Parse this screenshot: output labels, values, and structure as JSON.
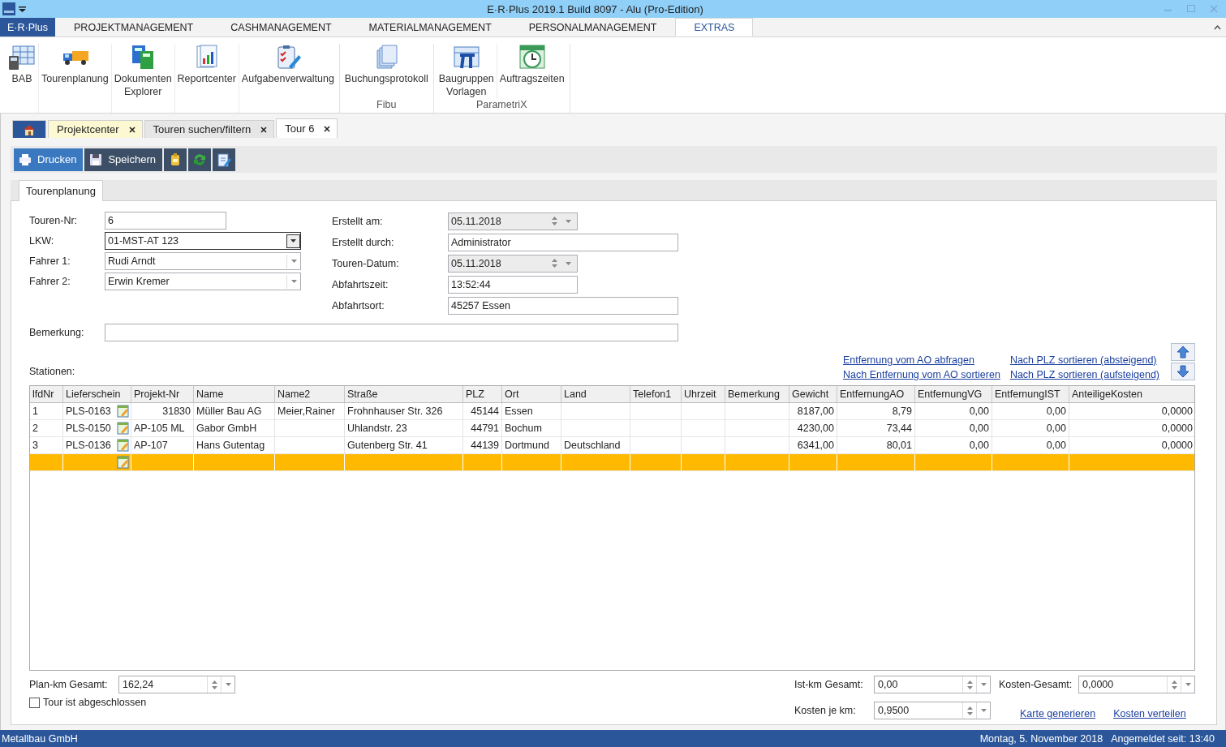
{
  "window": {
    "title": "E·R·Plus 2019.1 Build 8097 -  Alu (Pro-Edition)"
  },
  "menu": {
    "tabs": [
      {
        "label": "E·R·Plus",
        "kind": "app",
        "selected": false
      },
      {
        "label": "PROJEKTMANAGEMENT",
        "kind": "tab",
        "selected": false
      },
      {
        "label": "CASHMANAGEMENT",
        "kind": "tab",
        "selected": false
      },
      {
        "label": "MATERIALMANAGEMENT",
        "kind": "tab",
        "selected": false
      },
      {
        "label": "PERSONALMANAGEMENT",
        "kind": "tab",
        "selected": false
      },
      {
        "label": "EXTRAS",
        "kind": "tab",
        "selected": true
      }
    ]
  },
  "ribbon": {
    "groups": [
      {
        "items": [
          {
            "label": "BAB"
          },
          {
            "label": "Tourenplanung"
          },
          {
            "label": "Dokumenten\nExplorer"
          },
          {
            "label": "Reportcenter"
          },
          {
            "label": "Aufgabenverwaltung"
          }
        ]
      },
      {
        "label": "Fibu",
        "items": [
          {
            "label": "Buchungsprotokoll"
          }
        ]
      },
      {
        "label": "ParametriX",
        "items": [
          {
            "label": "Baugruppen\nVorlagen"
          },
          {
            "label": "Auftragszeiten"
          }
        ]
      }
    ]
  },
  "document_tabs": [
    {
      "kind": "home",
      "selected": false
    },
    {
      "kind": "tab",
      "label": "Projektcenter",
      "selected": false,
      "color": "#fbf8d2"
    },
    {
      "kind": "tab",
      "label": "Touren suchen/filtern",
      "selected": false,
      "color": "#e6e6e6"
    },
    {
      "kind": "tab",
      "label": "Tour 6",
      "selected": true
    }
  ],
  "toolbar": [
    {
      "kind": "primary",
      "label": "Drucken"
    },
    {
      "kind": "dark",
      "label": "Speichern"
    },
    {
      "kind": "icon"
    },
    {
      "kind": "icon"
    },
    {
      "kind": "icon"
    }
  ],
  "page_tabs": [
    {
      "label": "Tourenplanung",
      "selected": true
    }
  ],
  "form": {
    "left": [
      {
        "label": "Touren-Nr:",
        "value": "6",
        "kind": "text",
        "focused": false
      },
      {
        "label": "LKW:",
        "value": "01-MST-AT 123",
        "kind": "combo",
        "focused": true
      },
      {
        "label": "Fahrer 1:",
        "value": "Rudi Arndt",
        "kind": "combo",
        "focused": false
      },
      {
        "label": "Fahrer 2:",
        "value": "Erwin Kremer",
        "kind": "combo",
        "focused": false
      }
    ],
    "right": [
      {
        "label": "Erstellt am:",
        "value": "05.11.2018",
        "kind": "date",
        "disabled": true
      },
      {
        "label": "Erstellt durch:",
        "value": "Administrator",
        "kind": "wide",
        "disabled": false
      },
      {
        "label": "Touren-Datum:",
        "value": "05.11.2018",
        "kind": "date",
        "disabled": true
      },
      {
        "label": "Abfahrtszeit:",
        "value": "13:52:44",
        "kind": "text",
        "disabled": false
      },
      {
        "label": "Abfahrtsort:",
        "value": "45257 Essen",
        "kind": "wide",
        "disabled": false
      }
    ],
    "remark": {
      "label": "Bemerkung:"
    }
  },
  "stations": {
    "label": "Stationen:",
    "links": [
      "Entfernung vom AO abfragen",
      "Nach PLZ sortieren (absteigend)",
      "Nach Entfernung vom AO sortieren",
      "Nach PLZ sortieren (aufsteigend)"
    ],
    "columns": [
      "lfdNr",
      "Lieferschein",
      "Projekt-Nr",
      "Name",
      "Name2",
      "Straße",
      "PLZ",
      "Ort",
      "Land",
      "Telefon1",
      "Uhrzeit",
      "Bemerkung",
      "Gewicht",
      "EntfernungAO",
      "EntfernungVG",
      "EntfernungIST",
      "AnteiligeKosten"
    ],
    "rows": [
      {
        "selected": false,
        "cells": [
          "1",
          "PLS-0163",
          "31830",
          "Müller Bau AG",
          "Meier,Rainer",
          "Frohnhauser Str. 326",
          "45144",
          "Essen",
          null,
          null,
          null,
          null,
          "8187,00",
          "8,79",
          "0,00",
          "0,00",
          "0,0000"
        ]
      },
      {
        "selected": false,
        "cells": [
          "2",
          "PLS-0150",
          "AP-105 ML",
          "Gabor GmbH",
          null,
          "Uhlandstr. 23",
          "44791",
          "Bochum",
          null,
          null,
          null,
          null,
          "4230,00",
          "73,44",
          "0,00",
          "0,00",
          "0,0000"
        ]
      },
      {
        "selected": false,
        "cells": [
          "3",
          "PLS-0136",
          "AP-107",
          "Hans Gutentag",
          null,
          "Gutenberg Str. 41",
          "44139",
          "Dortmund",
          "Deutschland",
          null,
          null,
          null,
          "6341,00",
          "80,01",
          "0,00",
          "0,00",
          "0,0000"
        ]
      },
      {
        "selected": true,
        "cells": [
          null,
          null,
          null,
          null,
          null,
          null,
          null,
          null,
          null,
          null,
          null,
          null,
          null,
          null,
          null,
          null,
          null
        ]
      }
    ]
  },
  "totals": {
    "plan_km": {
      "label": "Plan-km Gesamt:",
      "value": "162,24"
    },
    "closed": {
      "label": "Tour ist abgeschlossen",
      "checked": false
    },
    "fields": [
      {
        "label": "Ist-km Gesamt:",
        "value": "0,00"
      },
      {
        "label": "Kosten-Gesamt:",
        "value": "0,0000"
      },
      {
        "label": "Kosten je km:",
        "value": "0,9500"
      }
    ],
    "links": [
      "Karte generieren",
      "Kosten verteilen"
    ]
  },
  "status_bar": {
    "company": "Metallbau GmbH",
    "date": "Montag, 5. November 2018",
    "login": "Angemeldet seit: 13:40"
  }
}
